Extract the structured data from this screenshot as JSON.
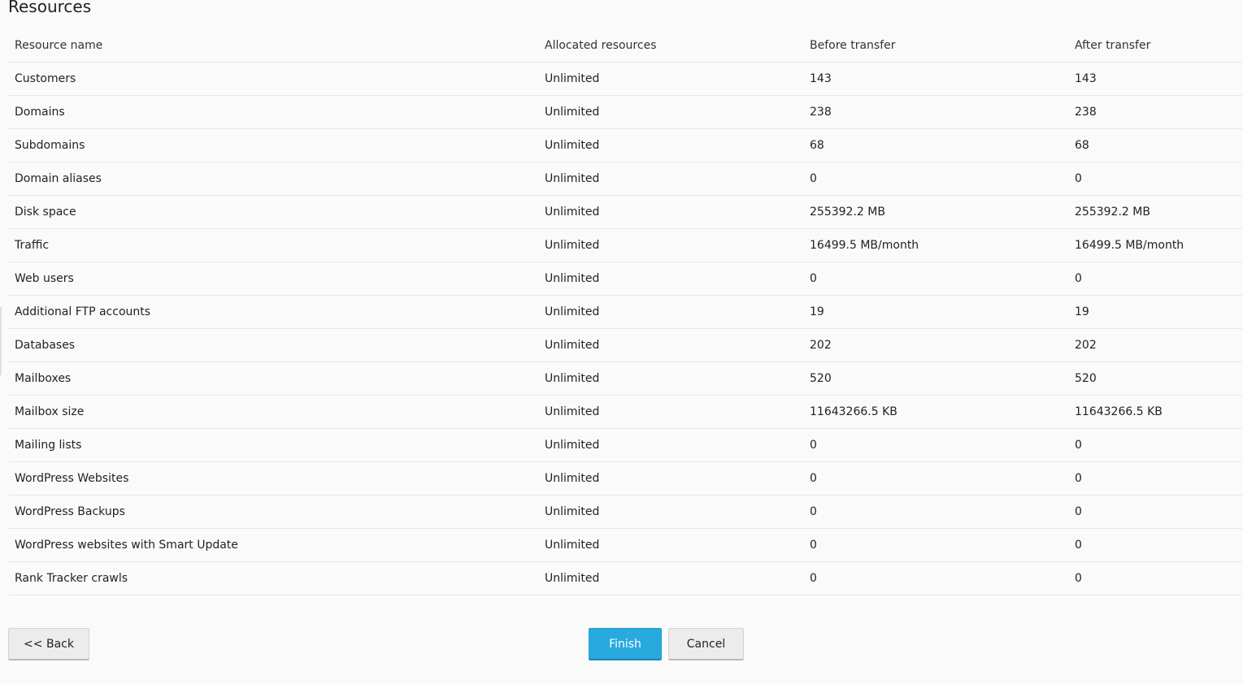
{
  "page": {
    "title": "Resources"
  },
  "table": {
    "headers": [
      "Resource name",
      "Allocated resources",
      "Before transfer",
      "After transfer"
    ],
    "rows": [
      [
        "Customers",
        "Unlimited",
        "143",
        "143"
      ],
      [
        "Domains",
        "Unlimited",
        "238",
        "238"
      ],
      [
        "Subdomains",
        "Unlimited",
        "68",
        "68"
      ],
      [
        "Domain aliases",
        "Unlimited",
        "0",
        "0"
      ],
      [
        "Disk space",
        "Unlimited",
        "255392.2 MB",
        "255392.2 MB"
      ],
      [
        "Traffic",
        "Unlimited",
        "16499.5 MB/month",
        "16499.5 MB/month"
      ],
      [
        "Web users",
        "Unlimited",
        "0",
        "0"
      ],
      [
        "Additional FTP accounts",
        "Unlimited",
        "19",
        "19"
      ],
      [
        "Databases",
        "Unlimited",
        "202",
        "202"
      ],
      [
        "Mailboxes",
        "Unlimited",
        "520",
        "520"
      ],
      [
        "Mailbox size",
        "Unlimited",
        "11643266.5 KB",
        "11643266.5 KB"
      ],
      [
        "Mailing lists",
        "Unlimited",
        "0",
        "0"
      ],
      [
        "WordPress Websites",
        "Unlimited",
        "0",
        "0"
      ],
      [
        "WordPress Backups",
        "Unlimited",
        "0",
        "0"
      ],
      [
        "WordPress websites with Smart Update",
        "Unlimited",
        "0",
        "0"
      ],
      [
        "Rank Tracker crawls",
        "Unlimited",
        "0",
        "0"
      ]
    ]
  },
  "buttons": {
    "back": "<< Back",
    "finish": "Finish",
    "cancel": "Cancel"
  },
  "colors": {
    "primary": "#28aade",
    "background": "#fafafa",
    "row_divider": "#e6e6e6"
  }
}
